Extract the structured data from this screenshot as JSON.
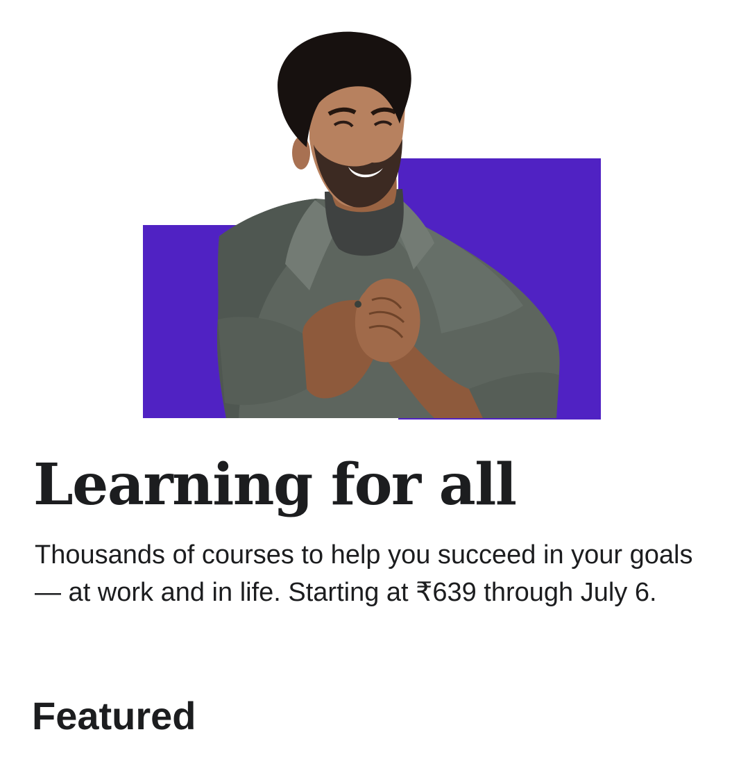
{
  "hero": {
    "image": "smiling-man-with-clasped-hands-photo",
    "accent_color": "#5022c3"
  },
  "headline": "Learning for all",
  "subtitle": "Thousands of courses to help you succeed in your goals — at work and in life. Starting at ₹639 through July 6.",
  "featured_heading": "Featured"
}
